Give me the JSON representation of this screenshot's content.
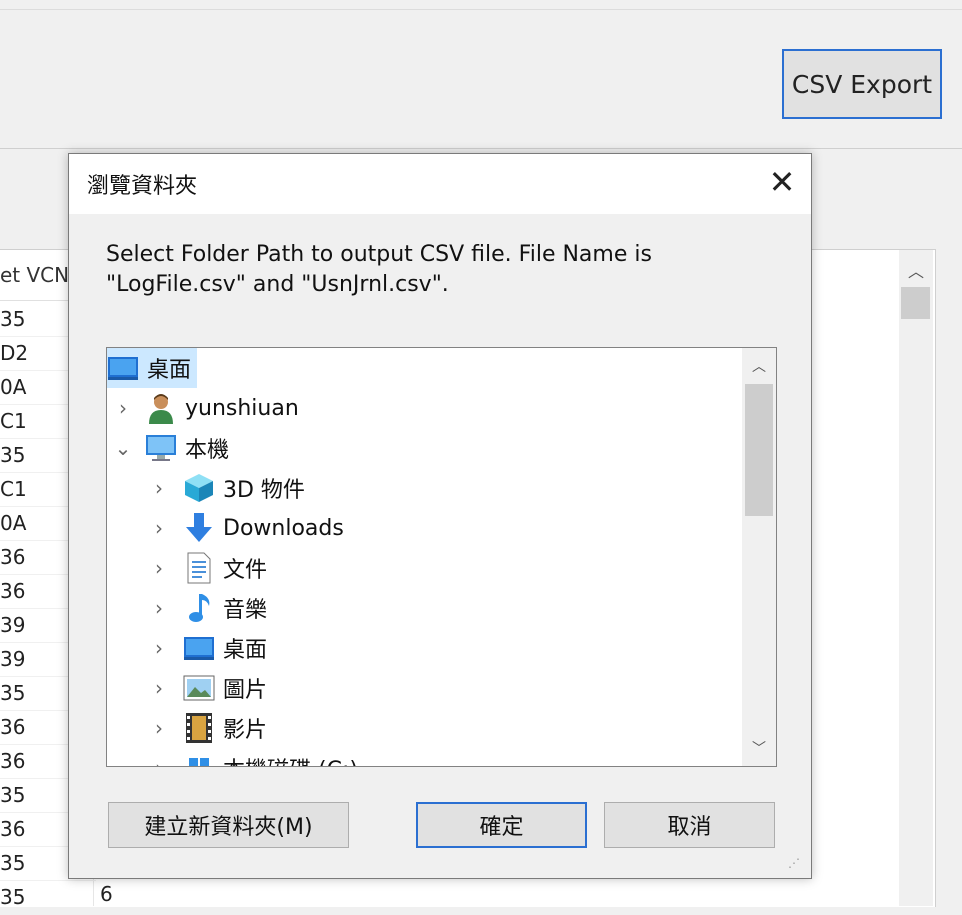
{
  "app": {
    "export_button": "CSV Export",
    "grid_header": "et VCN",
    "grid_rows": [
      "35",
      "D2",
      "0A",
      "C1",
      "35",
      "C1",
      "0A",
      "36",
      "36",
      "39",
      "39",
      "35",
      "36",
      "36",
      "35",
      "36",
      "35",
      "35"
    ],
    "bottom_cell": "6"
  },
  "dialog": {
    "title": "瀏覽資料夾",
    "description": "Select Folder Path to output CSV file. File Name is\n\"LogFile.csv\" and \"UsnJrnl.csv\".",
    "tree": [
      {
        "label": "桌面",
        "icon": "desktop-icon",
        "selected": true
      },
      {
        "label": "yunshiuan",
        "icon": "user-icon"
      },
      {
        "label": "本機",
        "icon": "computer-icon",
        "expanded": true
      },
      {
        "label": "3D 物件",
        "icon": "3d-objects-icon"
      },
      {
        "label": "Downloads",
        "icon": "downloads-icon"
      },
      {
        "label": "文件",
        "icon": "documents-icon"
      },
      {
        "label": "音樂",
        "icon": "music-icon"
      },
      {
        "label": "桌面",
        "icon": "desktop-icon"
      },
      {
        "label": "圖片",
        "icon": "pictures-icon"
      },
      {
        "label": "影片",
        "icon": "videos-icon"
      },
      {
        "label": "本機磁碟 (C:)",
        "icon": "drive-icon"
      }
    ],
    "new_folder_button": "建立新資料夾(M)",
    "ok_button": "確定",
    "cancel_button": "取消"
  },
  "colors": {
    "accent": "#2b6fd1",
    "selection": "#cce8ff"
  }
}
